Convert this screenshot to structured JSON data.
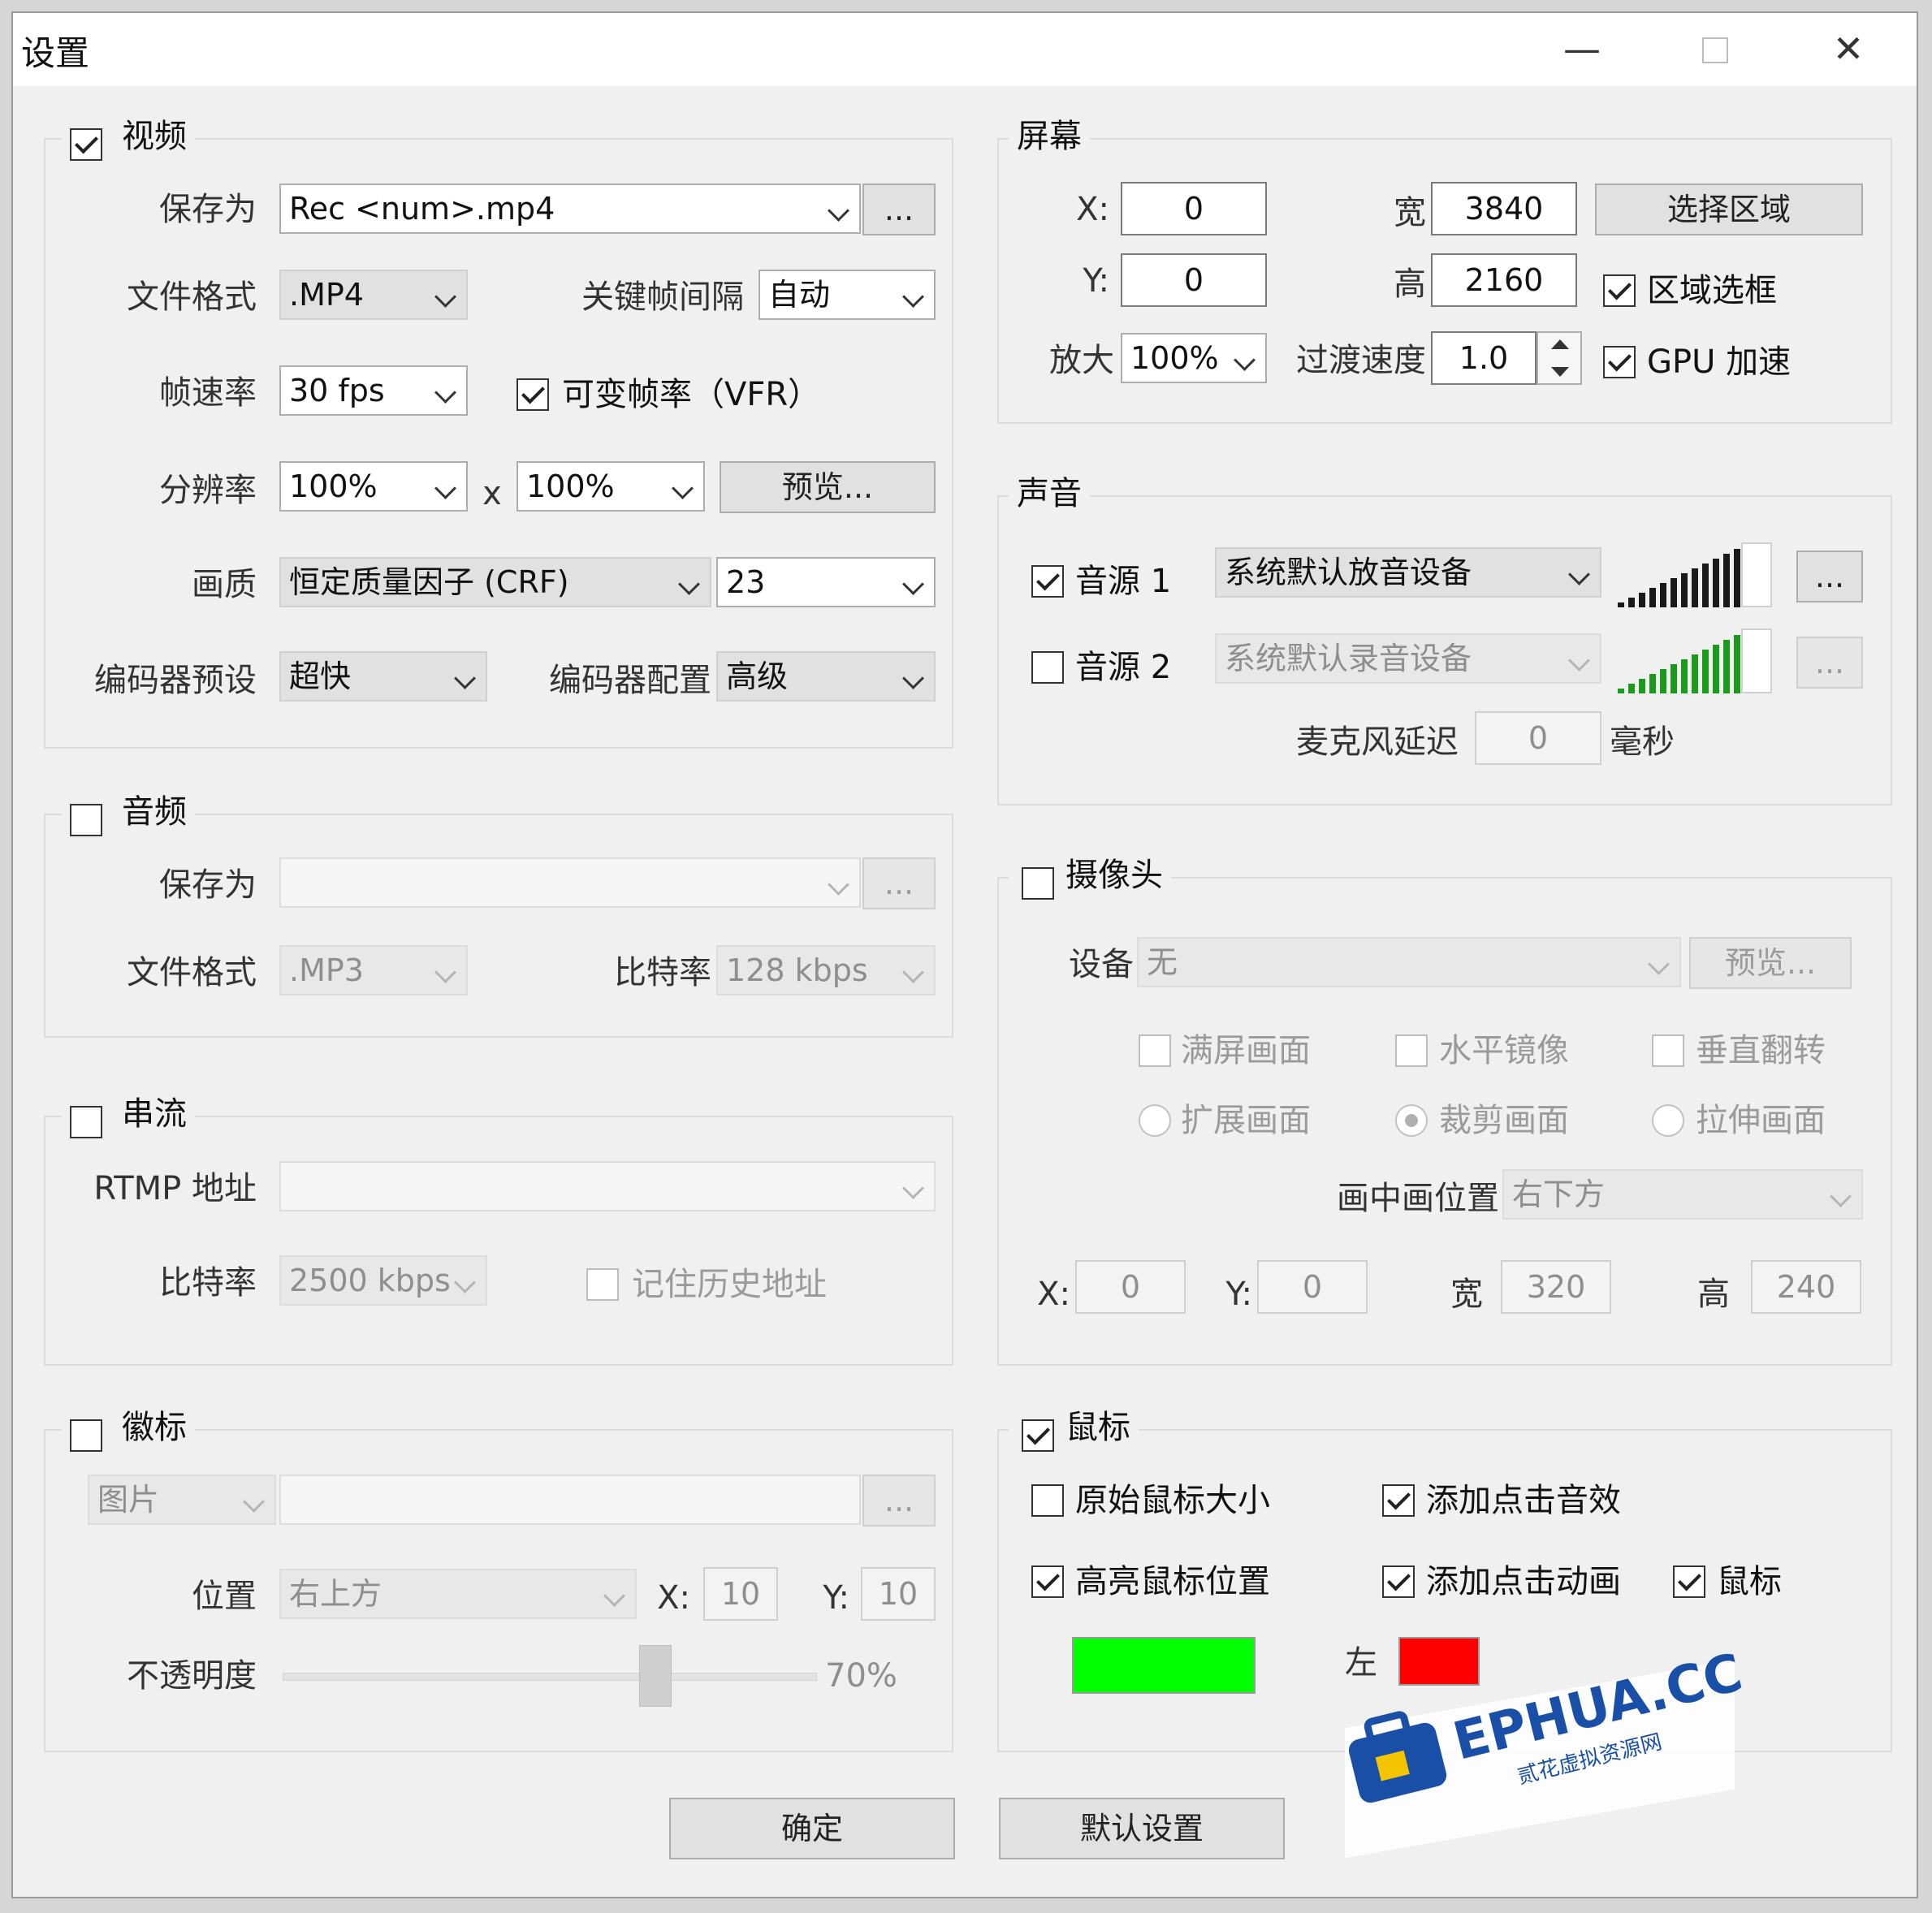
{
  "window": {
    "title": "设置"
  },
  "video": {
    "title": "视频",
    "enabled": true,
    "save_as_label": "保存为",
    "save_as_value": "Rec <num>.mp4",
    "browse": "...",
    "format_label": "文件格式",
    "format_value": ".MP4",
    "keyframe_label": "关键帧间隔",
    "keyframe_value": "自动",
    "fps_label": "帧速率",
    "fps_value": "30 fps",
    "vfr_label": "可变帧率（VFR）",
    "resolution_label": "分辨率",
    "res_w": "100%",
    "res_x": "x",
    "res_h": "100%",
    "preview": "预览...",
    "quality_label": "画质",
    "quality_mode": "恒定质量因子 (CRF)",
    "quality_value": "23",
    "preset_label": "编码器预设",
    "preset_value": "超快",
    "profile_label": "编码器配置",
    "profile_value": "高级"
  },
  "audio": {
    "title": "音频",
    "save_as_label": "保存为",
    "save_as_value": "",
    "browse": "...",
    "format_label": "文件格式",
    "format_value": ".MP3",
    "bitrate_label": "比特率",
    "bitrate_value": "128 kbps"
  },
  "stream": {
    "title": "串流",
    "rtmp_label": "RTMP 地址",
    "rtmp_value": "",
    "bitrate_label": "比特率",
    "bitrate_value": "2500 kbps",
    "history_label": "记住历史地址"
  },
  "logo": {
    "title": "徽标",
    "type_value": "图片",
    "path_value": "",
    "browse": "...",
    "position_label": "位置",
    "position_value": "右上方",
    "x_label": "X:",
    "x_value": "10",
    "y_label": "Y:",
    "y_value": "10",
    "opacity_label": "不透明度",
    "opacity_value": "70%",
    "opacity_fraction": 0.7
  },
  "screen": {
    "title": "屏幕",
    "x_label": "X:",
    "x_value": "0",
    "y_label": "Y:",
    "y_value": "0",
    "w_label": "宽",
    "w_value": "3840",
    "h_label": "高",
    "h_value": "2160",
    "select_area": "选择区域",
    "area_frame": "区域选框",
    "zoom_label": "放大",
    "zoom_value": "100%",
    "transition_label": "过渡速度",
    "transition_value": "1.0",
    "gpu_label": "GPU 加速"
  },
  "sound": {
    "title": "声音",
    "src1_label": "音源 1",
    "src1_device": "系统默认放音设备",
    "src2_label": "音源 2",
    "src2_device": "系统默认录音设备",
    "more": "...",
    "mic_delay_label": "麦克风延迟",
    "mic_delay_value": "0",
    "mic_delay_unit": "毫秒",
    "meter_color1": "#1a1a1a",
    "meter_color2": "#1c9a1c"
  },
  "camera": {
    "title": "摄像头",
    "device_label": "设备",
    "device_value": "无",
    "preview": "预览...",
    "fullscreen": "满屏画面",
    "mirror": "水平镜像",
    "flip": "垂直翻转",
    "extend": "扩展画面",
    "crop": "裁剪画面",
    "stretch": "拉伸画面",
    "pip_label": "画中画位置",
    "pip_value": "右下方",
    "x_label": "X:",
    "x_value": "0",
    "y_label": "Y:",
    "y_value": "0",
    "w_label": "宽",
    "w_value": "320",
    "h_label": "高",
    "h_value": "240"
  },
  "mouse": {
    "title": "鼠标",
    "orig_size": "原始鼠标大小",
    "click_sound": "添加点击音效",
    "highlight": "高亮鼠标位置",
    "click_anim": "添加点击动画",
    "trail": "鼠标",
    "left_label": "左",
    "highlight_color": "#00ff00",
    "left_color": "#ff0000"
  },
  "buttons": {
    "ok": "确定",
    "default": "默认设置"
  },
  "watermark": {
    "brand": "EPHUA.CC",
    "sub": "贰花虚拟资源网"
  }
}
